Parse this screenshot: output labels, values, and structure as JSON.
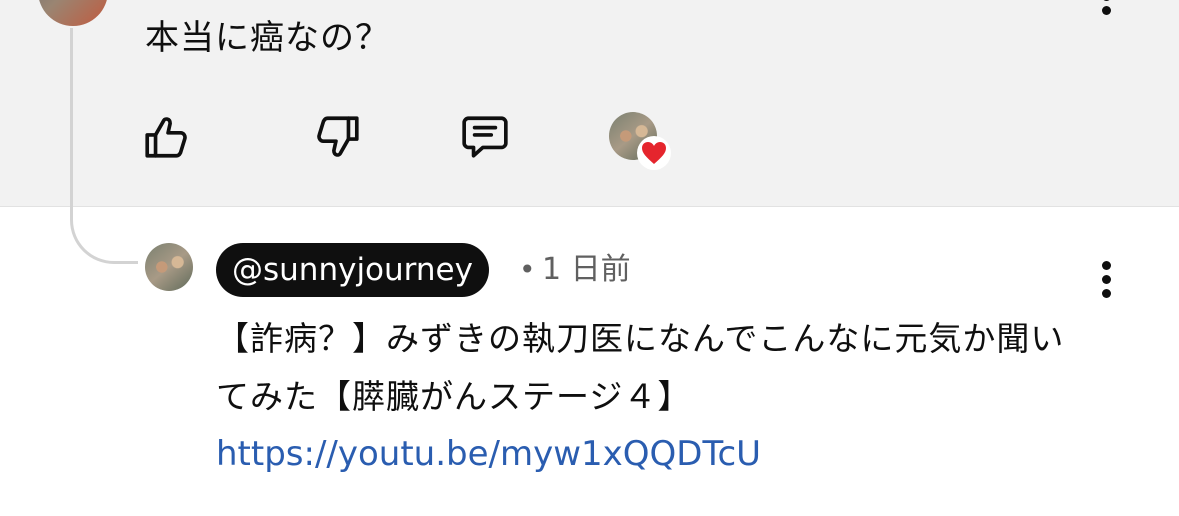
{
  "parent_comment": {
    "text": "本当に癌なの？",
    "actions": {
      "like_icon": "thumbs-up-icon",
      "dislike_icon": "thumbs-down-icon",
      "reply_icon": "comment-icon",
      "creator_heart_icon": "heart-icon"
    }
  },
  "reply": {
    "handle": "@sunnyjourney",
    "separator": "•",
    "time": "1 日前",
    "text": "【詐病？】みずきの執刀医になんでこんなに元気か聞いてみた【膵臓がんステージ４】",
    "link": "https://youtu.be/myw1xQQDTcU"
  },
  "colors": {
    "parent_background": "#f2f2f2",
    "handle_background": "#0f0f0f",
    "link": "#2a5db0",
    "heart": "#e5252d"
  }
}
